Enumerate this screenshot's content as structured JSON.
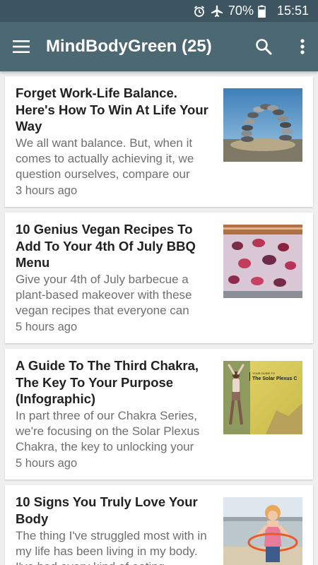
{
  "status": {
    "battery": "70%",
    "time": "15:51",
    "icons": [
      "alarm-icon",
      "airplane-icon",
      "battery-icon"
    ]
  },
  "appbar": {
    "title": "MindBodyGreen (25)",
    "icons": [
      "menu-icon",
      "search-icon",
      "more-vert-icon"
    ]
  },
  "colors": {
    "status_bar": "#3d5560",
    "app_bar": "#4c6873",
    "background": "#efefef",
    "card": "#ffffff"
  },
  "articles": [
    {
      "title": "Forget Work-Life Balance. Here's How To Win At Life Your Way",
      "snippet": "We all want balance. But, when it comes to actually achieving it, we question ourselves, compare our",
      "time": "3 hours ago",
      "thumbnail": "balanced-stones-arch"
    },
    {
      "title": "10 Genius Vegan Recipes To Add To Your 4th Of July BBQ Menu",
      "snippet": "Give your 4th of July barbecue a plant-based makeover with these vegan recipes that everyone can",
      "time": "5 hours ago",
      "thumbnail": "berry-ice-cream"
    },
    {
      "title": "A Guide To The Third Chakra, The Key To Your Purpose (Infographic)",
      "snippet": "In part three of our Chakra Series, we're focusing on the Solar Plexus Chakra, the key to unlocking your",
      "time": "5 hours ago",
      "thumbnail": "yoga-woman-infographic",
      "thumbnail_kicker": "YOUR GUIDE TO",
      "thumbnail_caption": "The Solar Plexus C"
    },
    {
      "title": "10 Signs You Truly Love Your Body",
      "snippet": "The thing I've struggled most with in my life has been living in my body. I've had every kind of eating",
      "time": "",
      "thumbnail": "woman-hula-hoop-beach"
    }
  ]
}
